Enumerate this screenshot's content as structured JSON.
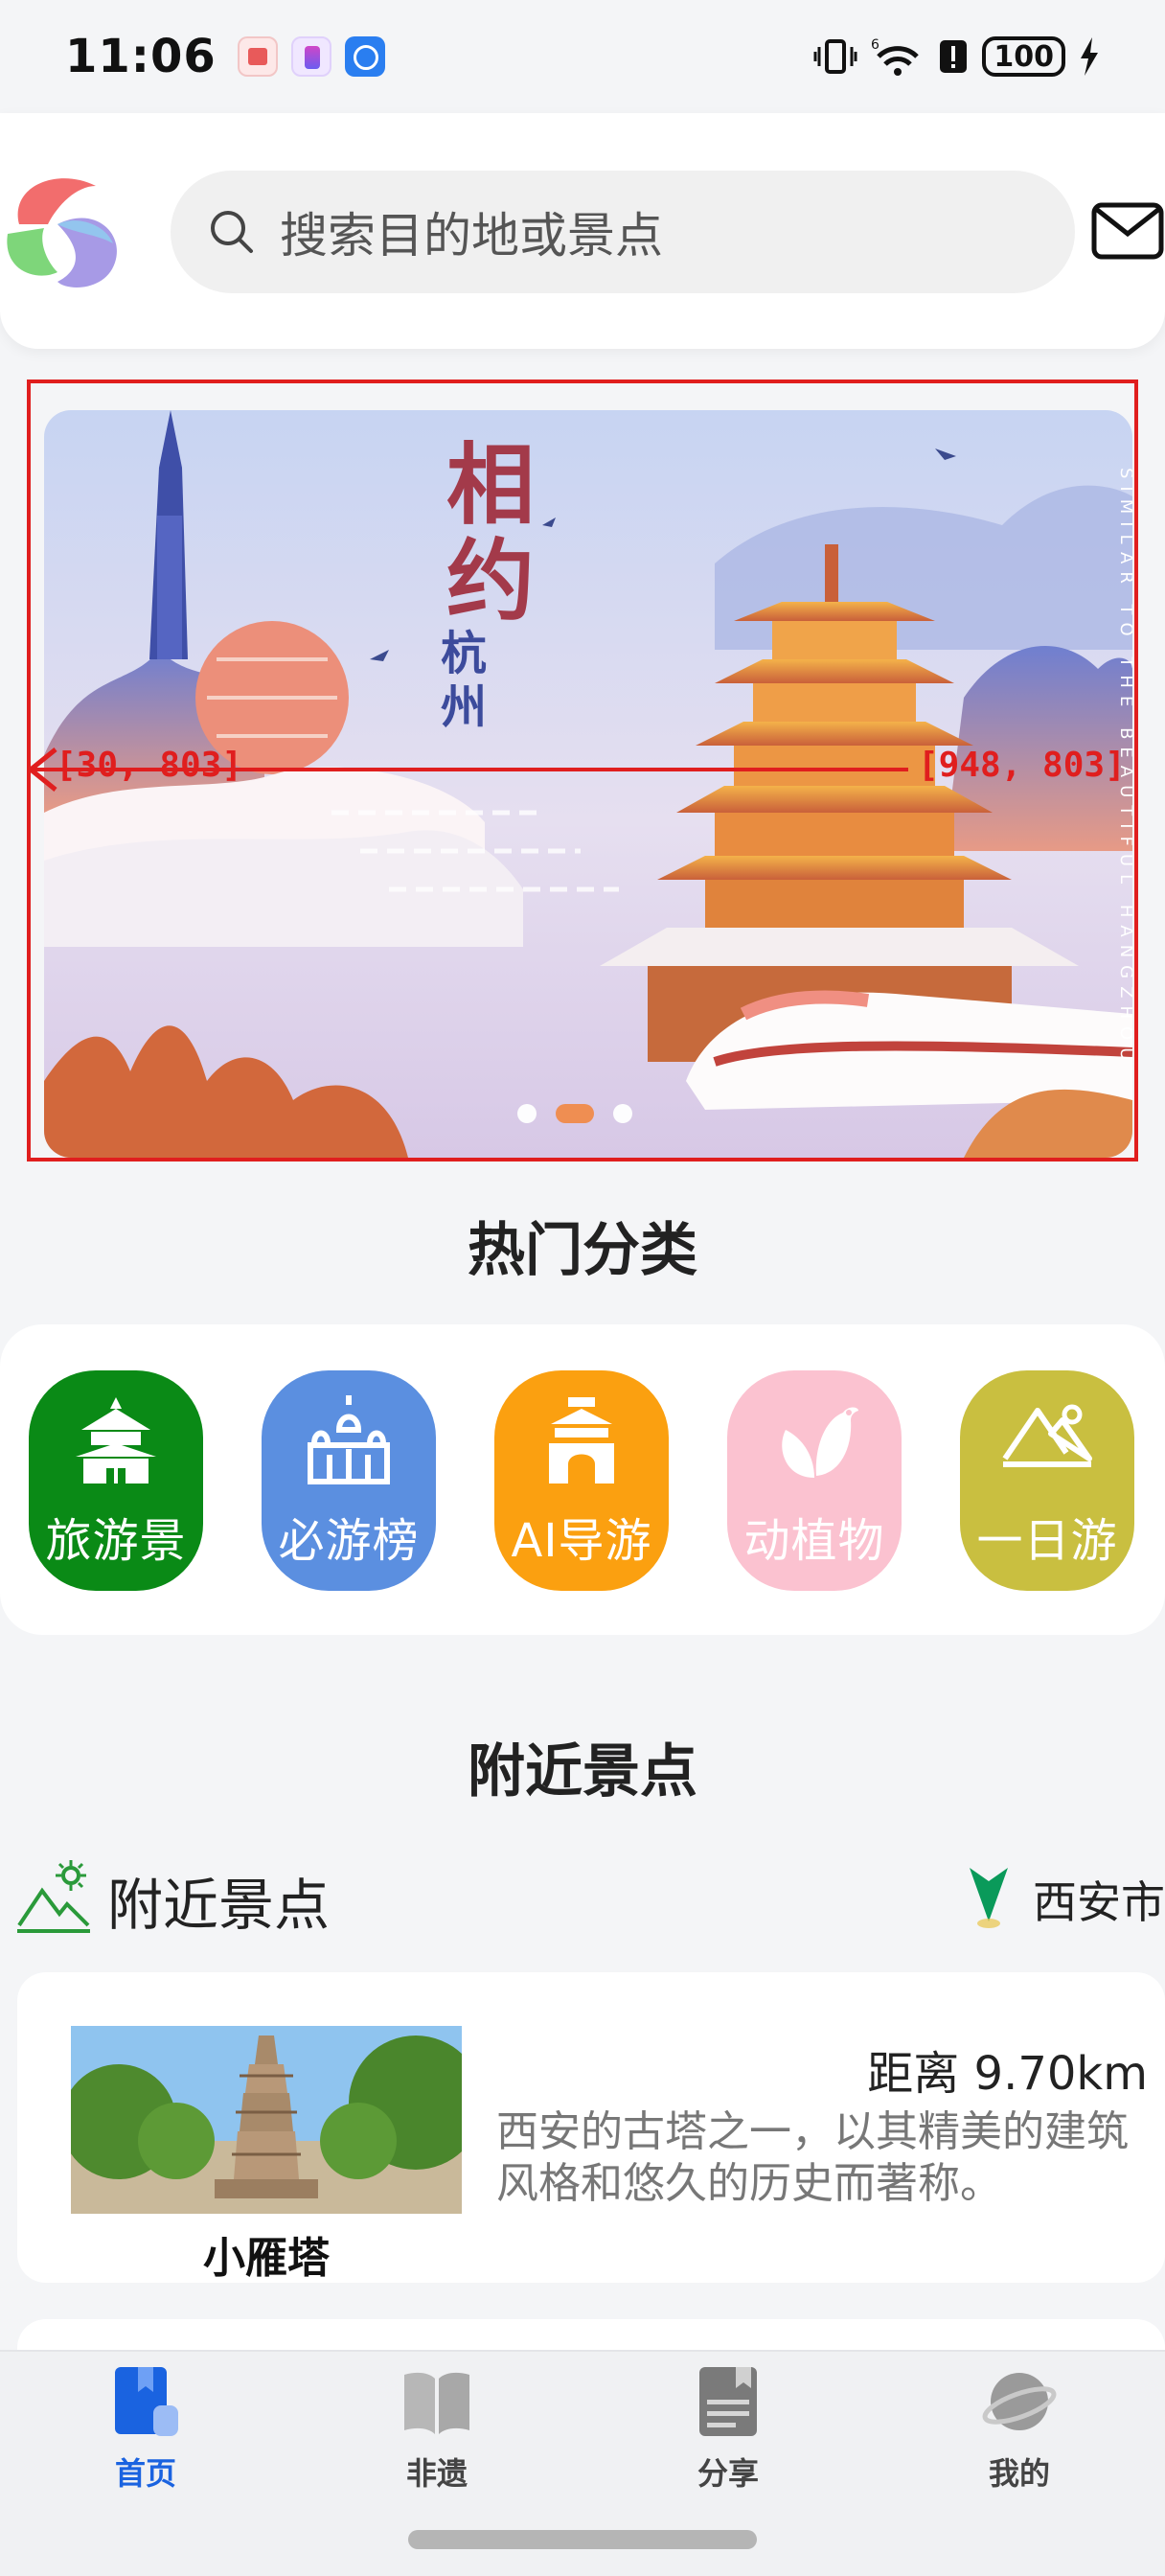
{
  "status_bar": {
    "time": "11:06",
    "battery": "100",
    "icons": [
      "vibrate-icon",
      "wifi-icon",
      "alert-icon",
      "battery-icon",
      "charging-icon"
    ]
  },
  "header": {
    "search_placeholder": "搜索目的地或景点"
  },
  "banner": {
    "title_chars": [
      "相",
      "约"
    ],
    "subtitle_chars": [
      "杭",
      "州"
    ],
    "side_text": "SIMILAR TO THE BEAUTIFUL HANGZHOU",
    "annotation_left": "[30, 803]",
    "annotation_right": "[948, 803]",
    "dot_count": 3,
    "active_dot": 1
  },
  "categories": {
    "title": "热门分类",
    "items": [
      {
        "label": "旅游景",
        "color": "#0a8a16",
        "icon": "temple-icon"
      },
      {
        "label": "必游榜",
        "color": "#5b8fe0",
        "icon": "palace-icon"
      },
      {
        "label": "AI导游",
        "color": "#fba010",
        "icon": "gate-icon"
      },
      {
        "label": "动植物",
        "color": "#fbc2d0",
        "icon": "bird-leaf-icon"
      },
      {
        "label": "一日游",
        "color": "#c9bf40",
        "icon": "mountain-icon"
      }
    ]
  },
  "nearby": {
    "section_title": "附近景点",
    "label": "附近景点",
    "city": "西安市",
    "spots": [
      {
        "name": "小雁塔",
        "distance": "距离 9.70km",
        "description": "西安的古塔之一，以其精美的建筑风格和悠久的历史而著称。"
      }
    ]
  },
  "bottom_nav": {
    "items": [
      {
        "label": "首页",
        "icon": "home-icon",
        "active": true
      },
      {
        "label": "非遗",
        "icon": "book-icon",
        "active": false
      },
      {
        "label": "分享",
        "icon": "notes-icon",
        "active": false
      },
      {
        "label": "我的",
        "icon": "planet-icon",
        "active": false
      }
    ]
  },
  "colors": {
    "accent": "#1a63e0",
    "annotation": "#e01e1e"
  }
}
